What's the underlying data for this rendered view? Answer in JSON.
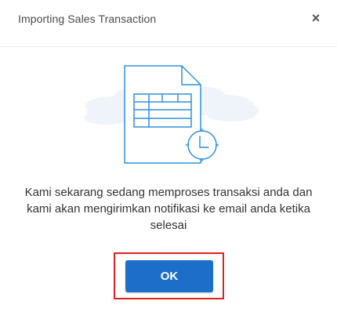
{
  "dialog": {
    "title": "Importing Sales Transaction",
    "close_label": "×",
    "message": "Kami sekarang sedang memproses transaksi anda dan kami akan mengirimkan notifikasi ke email anda ketika selesai",
    "ok_label": "OK"
  },
  "illustration": {
    "icon": "spreadsheet-document-clock-icon",
    "stroke_color": "#2f8fdc",
    "cloud_color": "#eef4f9"
  },
  "colors": {
    "primary": "#1c6ec9",
    "highlight": "#e0201f"
  }
}
